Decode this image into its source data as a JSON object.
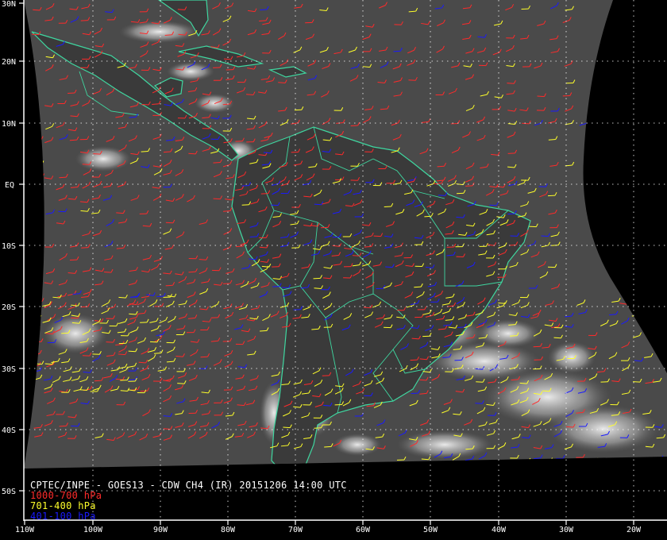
{
  "title": "CPTEC/INPE - GOES13 - CDW CH4 (IR) 20151206 14:00 UTC",
  "colors": {
    "background": "#000000",
    "coastline": "#3fd7a0",
    "grid": "#ffffff",
    "title_text": "#ffffff"
  },
  "latitude_labels": [
    "30N",
    "20N",
    "10N",
    "EQ",
    "10S",
    "20S",
    "30S",
    "40S",
    "50S"
  ],
  "longitude_labels": [
    "110W",
    "100W",
    "90W",
    "80W",
    "70W",
    "60W",
    "50W",
    "40W",
    "30W",
    "20W"
  ],
  "legend": [
    {
      "label": "1000-700 hPa",
      "color": "#ff2a2a"
    },
    {
      "label": "701-400 hPa",
      "color": "#ffff2a"
    },
    {
      "label": "401-100 hPa",
      "color": "#1a1aff"
    }
  ]
}
